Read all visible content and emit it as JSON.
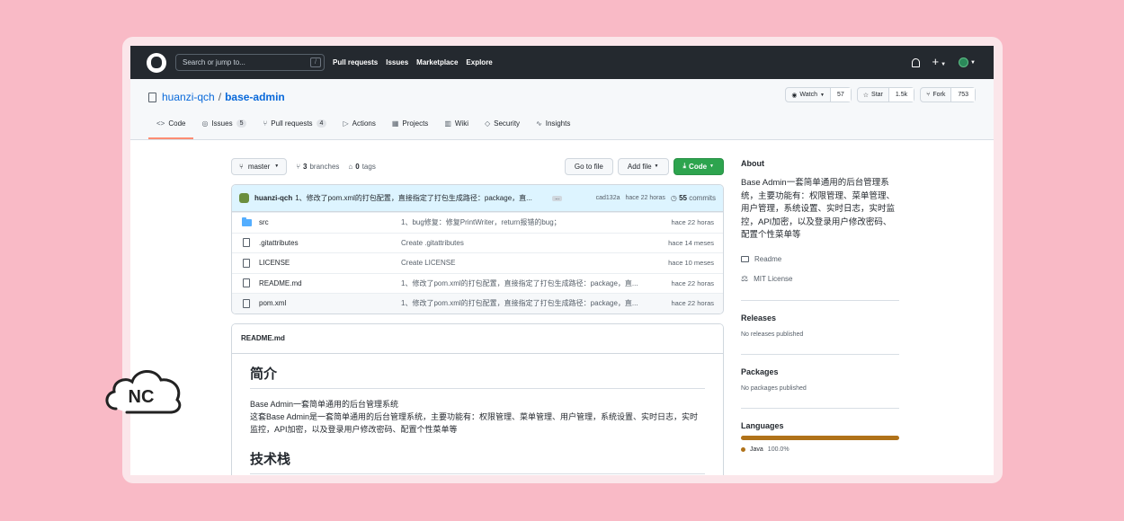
{
  "nav": {
    "search_placeholder": "Search or jump to...",
    "slash_key": "/",
    "links": [
      "Pull requests",
      "Issues",
      "Marketplace",
      "Explore"
    ]
  },
  "repo": {
    "owner": "huanzi-qch",
    "sep": "/",
    "name": "base-admin",
    "watch_label": "Watch",
    "watch_count": "57",
    "star_label": "Star",
    "star_count": "1.5k",
    "fork_label": "Fork",
    "fork_count": "753"
  },
  "tabs": [
    {
      "label": "Code",
      "icon": "<>",
      "count": ""
    },
    {
      "label": "Issues",
      "icon": "◎",
      "count": "5"
    },
    {
      "label": "Pull requests",
      "icon": "⑂",
      "count": "4"
    },
    {
      "label": "Actions",
      "icon": "▷",
      "count": ""
    },
    {
      "label": "Projects",
      "icon": "▦",
      "count": ""
    },
    {
      "label": "Wiki",
      "icon": "▥",
      "count": ""
    },
    {
      "label": "Security",
      "icon": "◇",
      "count": ""
    },
    {
      "label": "Insights",
      "icon": "∿",
      "count": ""
    }
  ],
  "toolbar": {
    "branch": "master",
    "branches_count": "3",
    "branches_label": "branches",
    "tags_count": "0",
    "tags_label": "tags",
    "goto_file": "Go to file",
    "add_file": "Add file",
    "code": "Code"
  },
  "commit": {
    "author": "huanzi-qch",
    "message": "1、修改了pom.xml的打包配置，直接指定了打包生成路径：package，直...",
    "ellipsis": "...",
    "sha": "cad132a",
    "time": "hace 22 horas",
    "commits_count": "55",
    "commits_label": "commits"
  },
  "files": [
    {
      "name": "src",
      "type": "folder",
      "message": "1、bug修复：修复PrintWriter，return报错的bug；",
      "time": "hace 22 horas"
    },
    {
      "name": ".gitattributes",
      "type": "file",
      "message": "Create .gitattributes",
      "time": "hace 14 meses"
    },
    {
      "name": "LICENSE",
      "type": "file",
      "message": "Create LICENSE",
      "time": "hace 10 meses"
    },
    {
      "name": "README.md",
      "type": "file",
      "message": "1、修改了pom.xml的打包配置，直接指定了打包生成路径：package，直...",
      "time": "hace 22 horas"
    },
    {
      "name": "pom.xml",
      "type": "file",
      "message": "1、修改了pom.xml的打包配置，直接指定了打包生成路径：package，直...",
      "time": "hace 22 horas"
    }
  ],
  "readme": {
    "title": "README.md",
    "h1": "简介",
    "line1": "Base Admin一套简单通用的后台管理系统",
    "line2": "这套Base Admin是一套简单通用的后台管理系统，主要功能有：权限管理、菜单管理、用户管理，系统设置、实时日志，实时监控，API加密，以及登录用户修改密码、配置个性菜单等",
    "h2": "技术栈"
  },
  "about": {
    "title": "About",
    "description": "Base Admin一套简单通用的后台管理系统，主要功能有：权限管理、菜单管理、用户管理，系统设置、实时日志，实时监控，API加密，以及登录用户修改密码、配置个性菜单等",
    "readme_link": "Readme",
    "license_link": "MIT License"
  },
  "releases": {
    "title": "Releases",
    "note": "No releases published"
  },
  "packages": {
    "title": "Packages",
    "note": "No packages published"
  },
  "languages": {
    "title": "Languages",
    "items": [
      {
        "name": "Java",
        "percent": "100.0%",
        "color": "#b07219"
      }
    ]
  },
  "watermark": {
    "text": "NC"
  }
}
